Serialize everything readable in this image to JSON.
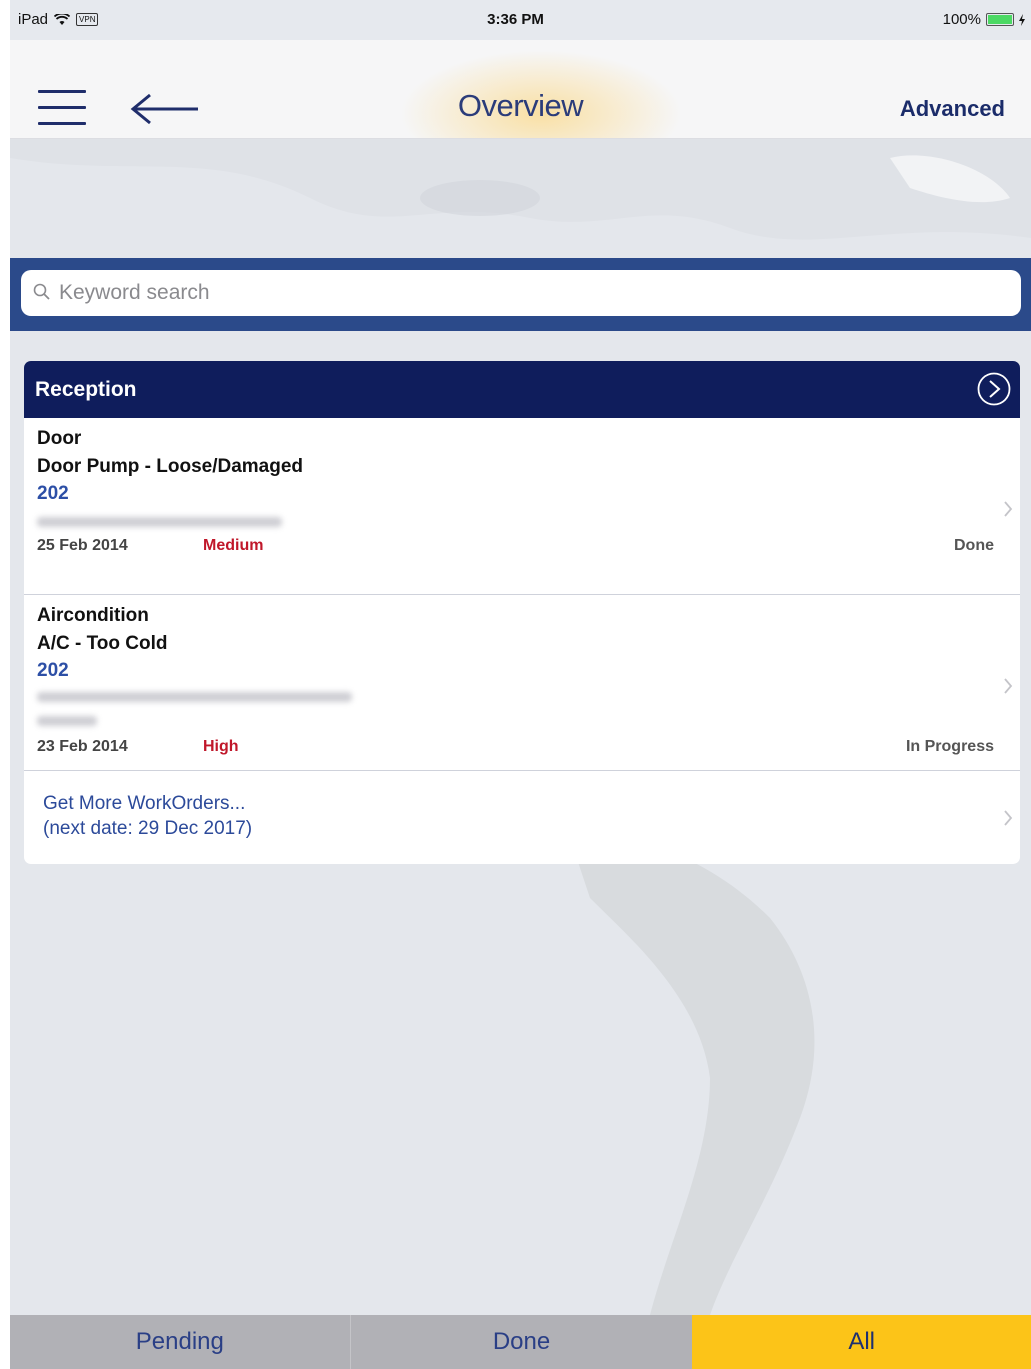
{
  "status_bar": {
    "device": "iPad",
    "vpn": "VPN",
    "time": "3:36 PM",
    "battery": "100%"
  },
  "nav": {
    "title": "Overview",
    "advanced": "Advanced"
  },
  "search": {
    "placeholder": "Keyword search",
    "value": ""
  },
  "section": {
    "title": "Reception"
  },
  "work_orders": [
    {
      "category": "Door",
      "title": "Door Pump - Loose/Damaged",
      "room": "202",
      "date": "25 Feb 2014",
      "priority": "Medium",
      "status": "Done"
    },
    {
      "category": "Aircondition",
      "title": "A/C - Too Cold",
      "room": "202",
      "date": "23 Feb 2014",
      "priority": "High",
      "status": "In Progress"
    }
  ],
  "more": {
    "line1": "Get More WorkOrders...",
    "line2": "(next date: 29 Dec 2017)"
  },
  "tabs": {
    "pending": "Pending",
    "done": "Done",
    "all": "All",
    "selected": "All"
  },
  "colors": {
    "header_navy": "#0f1d5c",
    "search_band": "#2b4a8a",
    "priority_red": "#c0172a",
    "tab_selected": "#fcc418",
    "tab_default": "#b1b1b6"
  }
}
